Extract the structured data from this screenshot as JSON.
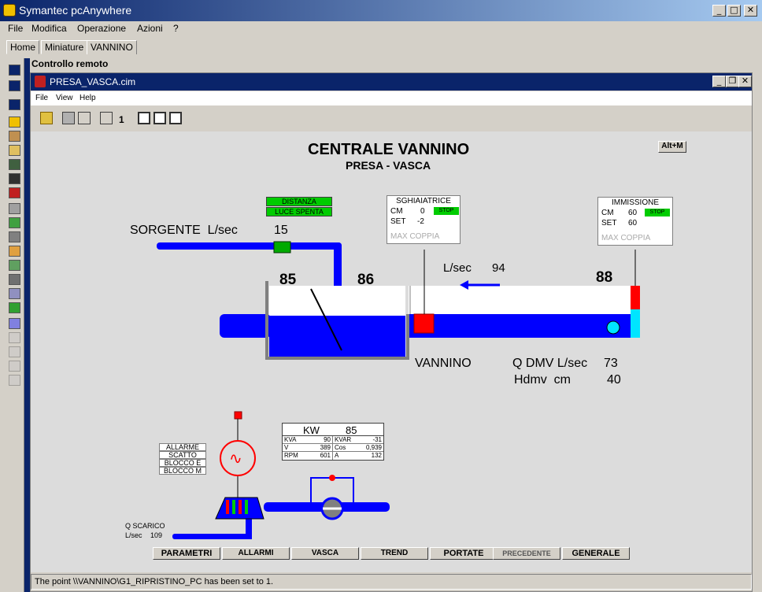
{
  "app": {
    "title": "Symantec pcAnywhere"
  },
  "outer_menu": [
    "File",
    "Modifica",
    "Operazione",
    "Azioni",
    "?"
  ],
  "tabs": [
    "Home",
    "Miniature",
    "VANNINO"
  ],
  "control_header": "Controllo remoto",
  "inner_window": {
    "title": "PRESA_VASCA.cim",
    "menu": [
      "File",
      "View",
      "Help"
    ],
    "toolbar_value": "1"
  },
  "screen": {
    "title": "CENTRALE VANNINO",
    "subtitle": "PRESA - VASCA",
    "alt_m": "Alt+M",
    "distanza": "DISTANZA",
    "luce_spenta": "LUCE SPENTA",
    "sorgente_label": "SORGENTE  L/sec",
    "sorgente_value": "15",
    "level_left": "85",
    "level_mid": "86",
    "level_right": "88",
    "flow_label": "L/sec",
    "flow_value": "94",
    "vannino": "VANNINO",
    "qdmv_label": "Q DMV L/sec",
    "qdmv_value": "73",
    "hdmv_label": "Hdmv  cm",
    "hdmv_value": "40",
    "sghiaiatrice": {
      "title": "SGHIAIATRICE",
      "cm_label": "CM",
      "cm_value": "0",
      "stop": "STOP",
      "set_label": "SET",
      "set_value": "-2",
      "max": "MAX COPPIA"
    },
    "immissione": {
      "title": "IMMISSIONE",
      "cm_label": "CM",
      "cm_value": "60",
      "stop": "STOP",
      "set_label": "SET",
      "set_value": "60",
      "max": "MAX COPPIA"
    },
    "alarms": [
      "ALLARME",
      "SCATTO",
      "BLOCCO E",
      "BLOCCO M"
    ],
    "kw": {
      "label": "KW",
      "value": "85",
      "rows": [
        [
          "KVA",
          "90",
          "KVAR",
          "-31"
        ],
        [
          "V",
          "389",
          "Cos",
          "0,939"
        ],
        [
          "RPM",
          "601",
          "A",
          "132"
        ]
      ]
    },
    "q_scarico": "Q SCARICO",
    "q_scarico_unit": "L/sec",
    "q_scarico_value": "109",
    "buttons": [
      "PARAMETRI",
      "ALLARMI",
      "VASCA",
      "TREND",
      "PORTATE",
      "PRECEDENTE",
      "GENERALE"
    ]
  },
  "status": "The point \\\\VANNINO\\G1_RIPRISTINO_PC has been set to 1.",
  "colors": {
    "pipe": "#0000ff",
    "green": "#00cc00",
    "red": "#ff0000",
    "cyan": "#00e5ff",
    "water": "#0000ff"
  }
}
